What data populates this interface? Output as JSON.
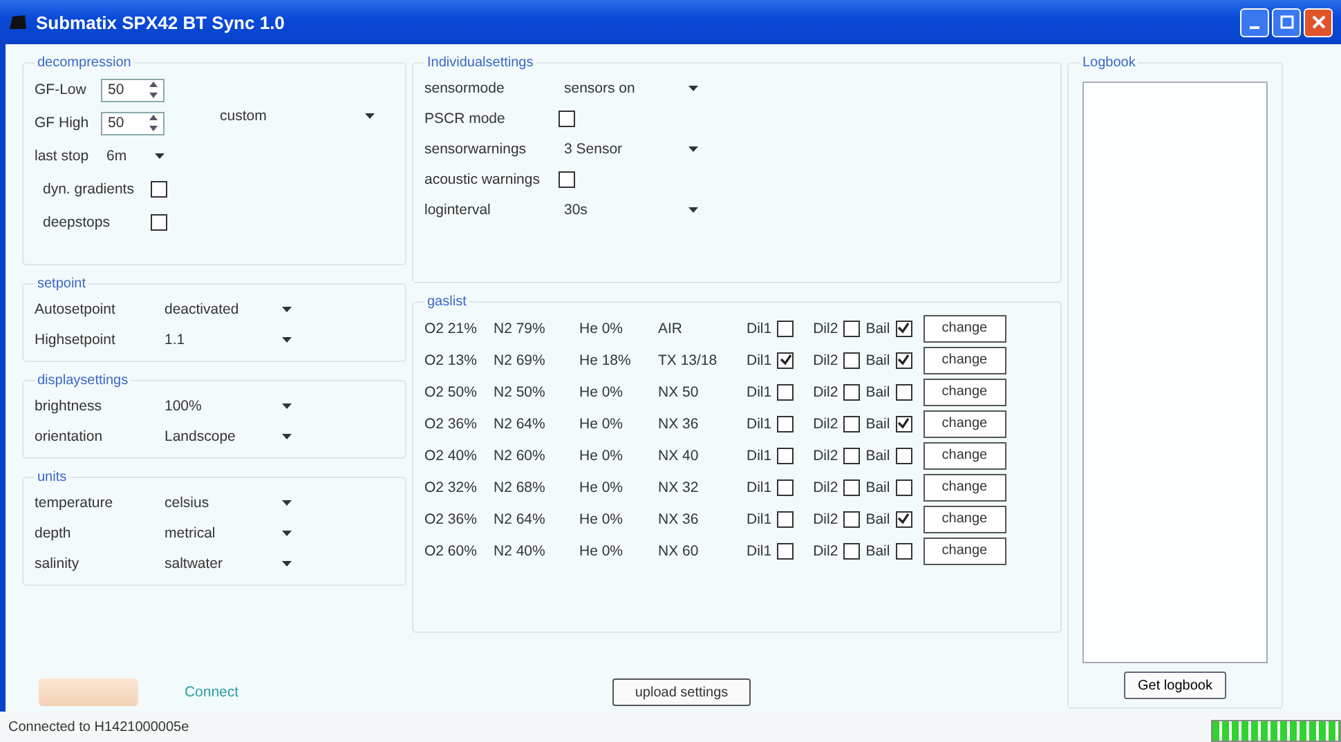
{
  "window": {
    "title": "Submatix SPX42 BT Sync 1.0"
  },
  "decompression": {
    "title": "decompression",
    "preset": "custom",
    "rows": [
      {
        "kind": "spin",
        "label": "GF-Low",
        "value": "50"
      },
      {
        "kind": "spin",
        "label": "GF High",
        "value": "50"
      },
      {
        "kind": "select",
        "label": "last stop",
        "value": "6m"
      },
      {
        "kind": "checkbox",
        "label": "dyn. gradients",
        "checked": false
      },
      {
        "kind": "checkbox",
        "label": "deepstops",
        "checked": false
      }
    ]
  },
  "left_groups": [
    {
      "title": "setpoint",
      "rows": [
        {
          "kind": "select",
          "label": "Autosetpoint",
          "value": "deactivated"
        },
        {
          "kind": "select",
          "label": "Highsetpoint",
          "value": "1.1"
        }
      ]
    },
    {
      "title": "displaysettings",
      "rows": [
        {
          "kind": "select",
          "label": "brightness",
          "value": "100%"
        },
        {
          "kind": "select",
          "label": "orientation",
          "value": "Landscope"
        }
      ]
    },
    {
      "title": "units",
      "rows": [
        {
          "kind": "select",
          "label": "temperature",
          "value": "celsius"
        },
        {
          "kind": "select",
          "label": "depth",
          "value": "metrical"
        },
        {
          "kind": "select",
          "label": "salinity",
          "value": "saltwater"
        }
      ]
    }
  ],
  "individual": {
    "title": "Individualsettings",
    "rows": [
      {
        "kind": "select",
        "label": "sensormode",
        "value": "sensors on"
      },
      {
        "kind": "checkbox",
        "label": "PSCR mode",
        "checked": false
      },
      {
        "kind": "select",
        "label": "sensorwarnings",
        "value": "3 Sensor"
      },
      {
        "kind": "checkbox",
        "label": "acoustic warnings",
        "checked": false
      },
      {
        "kind": "select",
        "label": "loginterval",
        "value": "30s"
      }
    ]
  },
  "gaslist": {
    "title": "gaslist",
    "rows": [
      {
        "o2": "O2 21%",
        "n2": "N2 79%",
        "he": "He 0%",
        "name": "AIR",
        "dil1": {
          "label": "Dil1",
          "checked": false
        },
        "dil2": {
          "label": "Dil2",
          "checked": false
        },
        "bail": {
          "label": "Bail",
          "checked": true
        },
        "button": "change"
      },
      {
        "o2": "O2 13%",
        "n2": "N2 69%",
        "he": "He 18%",
        "name": "TX 13/18",
        "dil1": {
          "label": "Dil1",
          "checked": true
        },
        "dil2": {
          "label": "Dil2",
          "checked": false
        },
        "bail": {
          "label": "Bail",
          "checked": true
        },
        "button": "change"
      },
      {
        "o2": "O2 50%",
        "n2": "N2 50%",
        "he": "He 0%",
        "name": "NX 50",
        "dil1": {
          "label": "Dil1",
          "checked": false
        },
        "dil2": {
          "label": "Dil2",
          "checked": false
        },
        "bail": {
          "label": "Bail",
          "checked": false
        },
        "button": "change"
      },
      {
        "o2": "O2 36%",
        "n2": "N2 64%",
        "he": "He 0%",
        "name": "NX 36",
        "dil1": {
          "label": "Dil1",
          "checked": false
        },
        "dil2": {
          "label": "Dil2",
          "checked": false
        },
        "bail": {
          "label": "Bail",
          "checked": true
        },
        "button": "change"
      },
      {
        "o2": "O2 40%",
        "n2": "N2 60%",
        "he": "He 0%",
        "name": "NX 40",
        "dil1": {
          "label": "Dil1",
          "checked": false
        },
        "dil2": {
          "label": "Dil2",
          "checked": false
        },
        "bail": {
          "label": "Bail",
          "checked": false
        },
        "button": "change"
      },
      {
        "o2": "O2 32%",
        "n2": "N2 68%",
        "he": "He 0%",
        "name": "NX 32",
        "dil1": {
          "label": "Dil1",
          "checked": false
        },
        "dil2": {
          "label": "Dil2",
          "checked": false
        },
        "bail": {
          "label": "Bail",
          "checked": false
        },
        "button": "change"
      },
      {
        "o2": "O2 36%",
        "n2": "N2 64%",
        "he": "He 0%",
        "name": "NX 36",
        "dil1": {
          "label": "Dil1",
          "checked": false
        },
        "dil2": {
          "label": "Dil2",
          "checked": false
        },
        "bail": {
          "label": "Bail",
          "checked": true
        },
        "button": "change"
      },
      {
        "o2": "O2 60%",
        "n2": "N2 40%",
        "he": "He 0%",
        "name": "NX 60",
        "dil1": {
          "label": "Dil1",
          "checked": false
        },
        "dil2": {
          "label": "Dil2",
          "checked": false
        },
        "bail": {
          "label": "Bail",
          "checked": false
        },
        "button": "change"
      }
    ]
  },
  "connect_button": "Connect",
  "upload_button": "upload settings",
  "logbook": {
    "title": "Logbook",
    "button": "Get logbook"
  },
  "status_bar": {
    "text": "Connected to H1421000005e",
    "progress": {
      "level": 1
    }
  }
}
